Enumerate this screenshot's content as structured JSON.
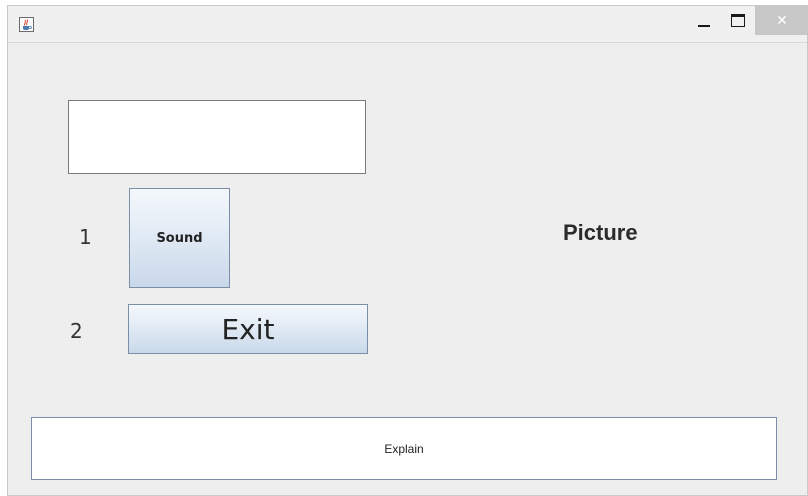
{
  "window": {
    "title": "",
    "controls": {
      "minimize_icon": "minimize-icon",
      "maximize_icon": "maximize-icon",
      "close_icon": "close-icon",
      "close_symbol": "✕"
    },
    "app_icon": "java-cup-icon"
  },
  "main": {
    "text_field_value": "",
    "rows": [
      {
        "number": "1",
        "button_label": "Sound"
      },
      {
        "number": "2",
        "button_label": "Exit"
      }
    ],
    "picture_label": "Picture",
    "explain_label": "Explain"
  },
  "colors": {
    "window_bg": "#eeeeee",
    "button_gradient_top": "#f4f8fc",
    "button_gradient_bottom": "#c9d8ea",
    "button_border": "#7a8ea8",
    "close_button_bg": "#c7c7c7"
  }
}
